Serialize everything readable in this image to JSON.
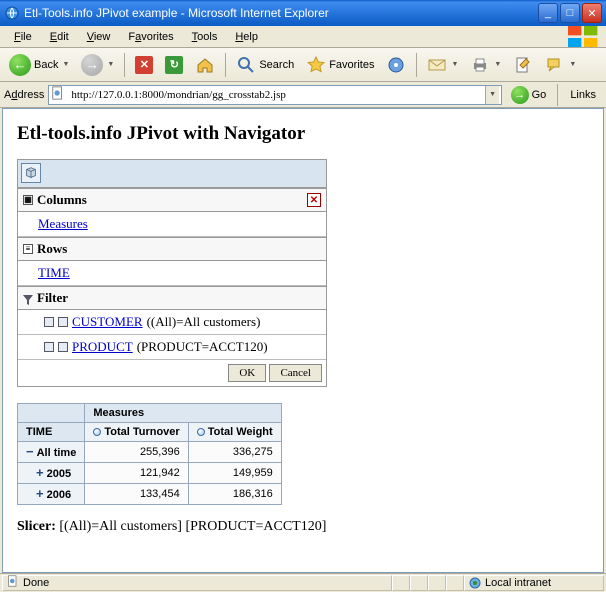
{
  "window": {
    "title": "Etl-Tools.info JPivot example - Microsoft Internet Explorer"
  },
  "menu": {
    "file": "File",
    "edit": "Edit",
    "view": "View",
    "favorites": "Favorites",
    "tools": "Tools",
    "help": "Help"
  },
  "toolbar": {
    "back": "Back",
    "search": "Search",
    "favorites": "Favorites"
  },
  "address": {
    "label": "Address",
    "url": "http://127.0.0.1:8000/mondrian/gg_crosstab2.jsp",
    "go": "Go",
    "links": "Links"
  },
  "page": {
    "heading": "Etl-tools.info JPivot with Navigator"
  },
  "nav": {
    "columns": "Columns",
    "measures": "Measures",
    "rows": "Rows",
    "time": "TIME",
    "filter": "Filter",
    "customer_link": "CUSTOMER",
    "customer_suffix": " ((All)=All customers)",
    "product_link": "PRODUCT",
    "product_suffix": " (PRODUCT=ACCT120)",
    "ok": "OK",
    "cancel": "Cancel"
  },
  "pivot": {
    "measures": "Measures",
    "time": "TIME",
    "turnover": "Total Turnover",
    "weight": "Total Weight",
    "rows": [
      {
        "label": "All time",
        "drill": "−",
        "turnover": "255,396",
        "weight": "336,275"
      },
      {
        "label": "2005",
        "drill": "+",
        "turnover": "121,942",
        "weight": "149,959"
      },
      {
        "label": "2006",
        "drill": "+",
        "turnover": "133,454",
        "weight": "186,316"
      }
    ]
  },
  "slicer": {
    "label": "Slicer:",
    "text": " [(All)=All customers] [PRODUCT=ACCT120]"
  },
  "status": {
    "done": "Done",
    "zone": "Local intranet"
  },
  "chart_data": {
    "type": "table",
    "title": "Etl-tools.info JPivot with Navigator",
    "column_dimension": "Measures",
    "row_dimension": "TIME",
    "columns": [
      "Total Turnover",
      "Total Weight"
    ],
    "rows": [
      "All time",
      "2005",
      "2006"
    ],
    "values": [
      [
        255396,
        336275
      ],
      [
        121942,
        149959
      ],
      [
        133454,
        186316
      ]
    ],
    "slicer": [
      "(All)=All customers",
      "PRODUCT=ACCT120"
    ]
  }
}
